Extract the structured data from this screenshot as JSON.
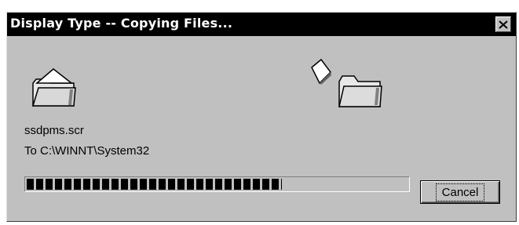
{
  "window": {
    "title": "Display Type -- Copying Files...",
    "close_icon": "close-icon"
  },
  "animation": {
    "source_icon": "folder-open-icon",
    "file_icon": "flying-document-icon",
    "destination_icon": "folder-icon"
  },
  "status": {
    "filename": "ssdpms.scr",
    "destination": "To C:\\WINNT\\System32"
  },
  "progress": {
    "fraction": 0.67
  },
  "buttons": {
    "cancel_label": "Cancel"
  },
  "colors": {
    "dialog_face": "#c0c0c0",
    "titlebar": "#000000",
    "title_text": "#ffffff"
  }
}
